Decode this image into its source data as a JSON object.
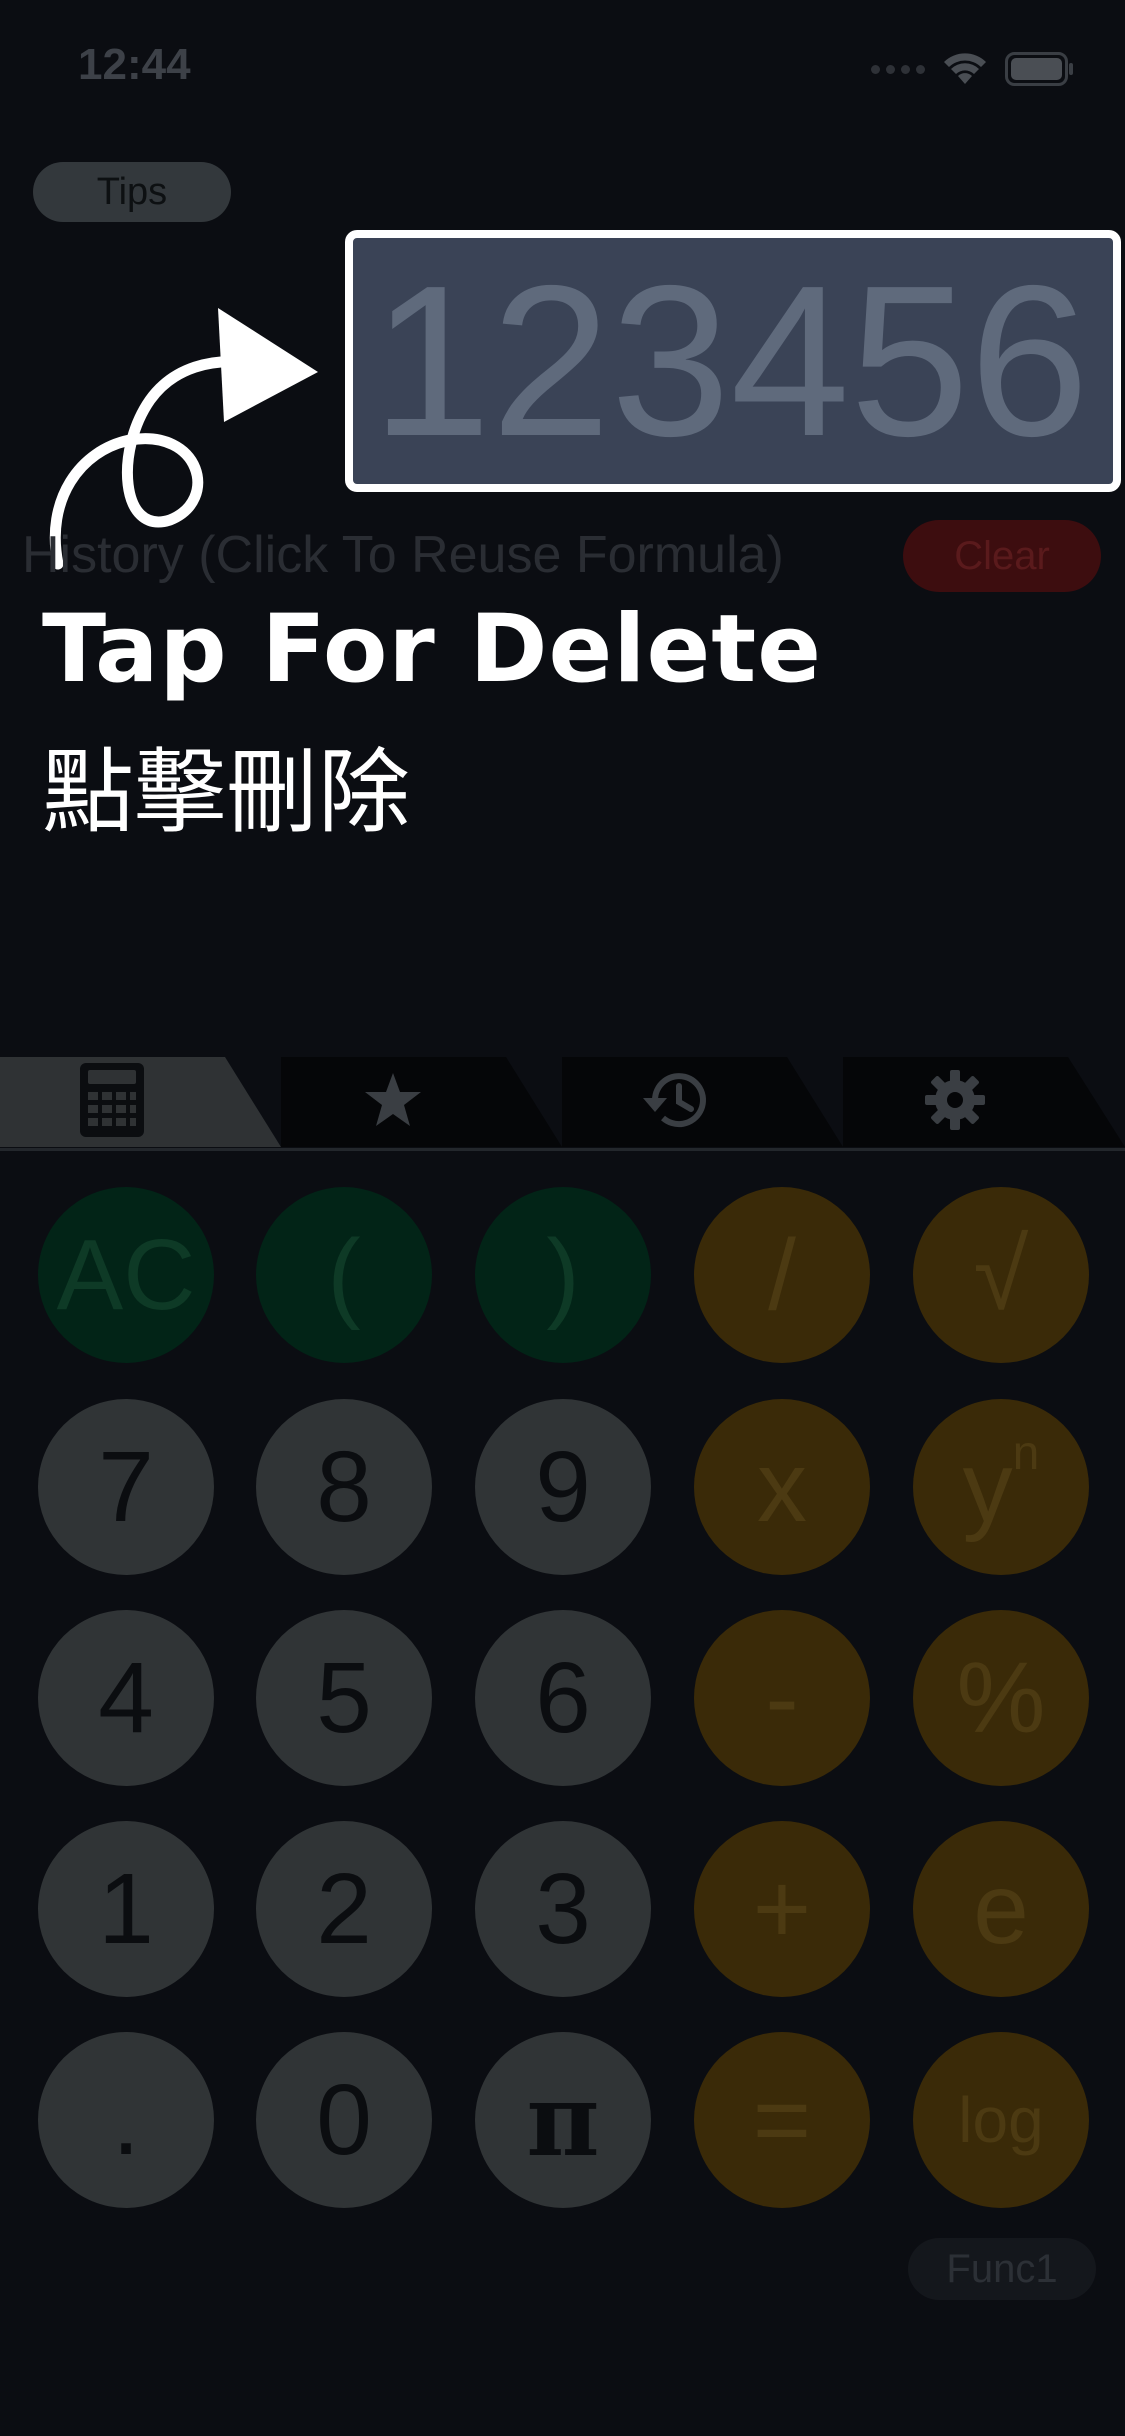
{
  "status_bar": {
    "time": "12:44"
  },
  "tips_button": {
    "label": "Tips"
  },
  "display": {
    "value": "123456"
  },
  "history": {
    "label": "History (Click To Reuse Formula)",
    "clear_label": "Clear"
  },
  "tip_overlay": {
    "title": "Tap For Delete",
    "subtitle": "點擊刪除"
  },
  "tabs": [
    {
      "name": "calculator",
      "icon": "calculator-icon",
      "active": true
    },
    {
      "name": "favorites",
      "icon": "star-icon",
      "active": false
    },
    {
      "name": "history",
      "icon": "history-clock-icon",
      "active": false
    },
    {
      "name": "settings",
      "icon": "gear-icon",
      "active": false
    }
  ],
  "keys": {
    "row1": [
      "AC",
      "(",
      ")",
      "/",
      "√"
    ],
    "row2": [
      "7",
      "8",
      "9",
      "x",
      "y"
    ],
    "row2_sup": "n",
    "row3": [
      "4",
      "5",
      "6",
      "-",
      "%"
    ],
    "row4": [
      "1",
      "2",
      "3",
      "+",
      "e"
    ],
    "row5": [
      ".",
      "0",
      "π",
      "=",
      "log"
    ]
  },
  "func_button": {
    "label": "Func1"
  },
  "colors": {
    "background": "#0b0d12",
    "display_fill": "#3a4356",
    "number_key": "#303436",
    "green_key": "#022417",
    "orange_key": "#3a2a08",
    "clear_button": "#3d0d0f"
  }
}
